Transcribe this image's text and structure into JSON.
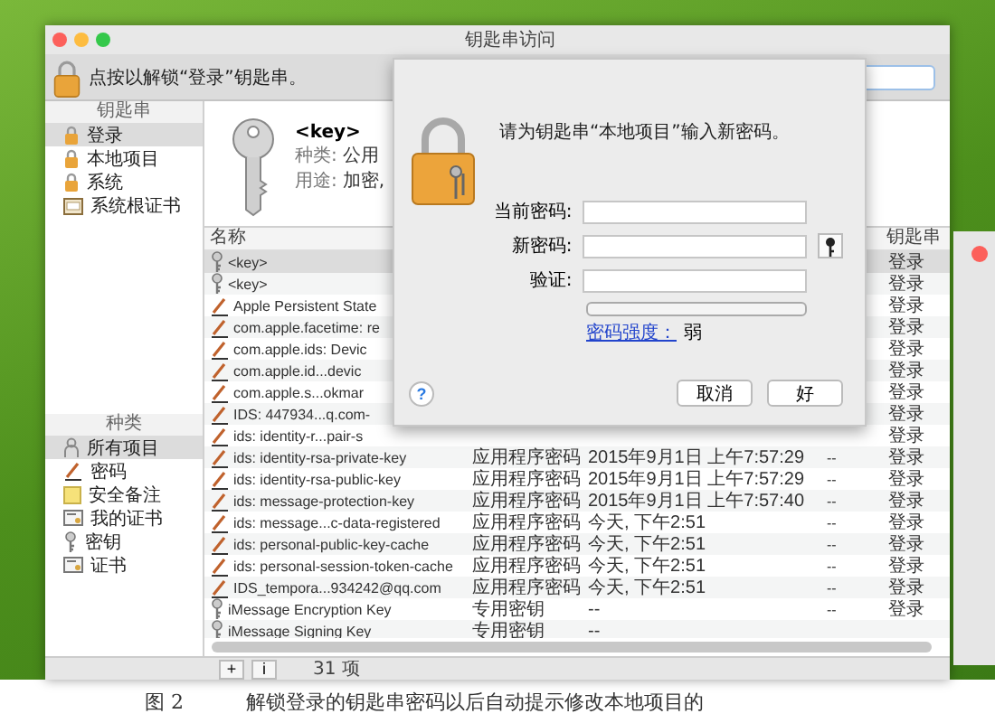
{
  "window": {
    "title": "钥匙串访问",
    "lock_message": "点按以解锁“登录”钥匙串。"
  },
  "sidebar": {
    "keychains_heading": "钥匙串",
    "keychains": [
      {
        "label": "登录",
        "kind": "lock",
        "selected": true
      },
      {
        "label": "本地项目",
        "kind": "lock",
        "selected": false
      },
      {
        "label": "系统",
        "kind": "lock",
        "selected": false
      },
      {
        "label": "系统根证书",
        "kind": "cabinet",
        "selected": false
      }
    ],
    "categories_heading": "种类",
    "categories": [
      {
        "label": "所有项目",
        "kind": "people",
        "selected": true
      },
      {
        "label": "密码",
        "kind": "pen",
        "selected": false
      },
      {
        "label": "安全备注",
        "kind": "note",
        "selected": false
      },
      {
        "label": "我的证书",
        "kind": "cert",
        "selected": false
      },
      {
        "label": "密钥",
        "kind": "key",
        "selected": false
      },
      {
        "label": "证书",
        "kind": "cert",
        "selected": false
      }
    ]
  },
  "detail": {
    "name": "<key>",
    "fields": [
      {
        "label": "种类:",
        "value": "公用"
      },
      {
        "label": "用途:",
        "value": "加密,"
      }
    ]
  },
  "table": {
    "columns": [
      "名称",
      "钥匙串"
    ],
    "rows": [
      {
        "kind": "key",
        "name": "<key>",
        "keychain": "登录",
        "selected": true
      },
      {
        "kind": "key",
        "name": "<key>",
        "keychain": "登录",
        "selected": false
      },
      {
        "kind": "password",
        "name": "Apple Persistent State",
        "keychain": "登录",
        "selected": false
      },
      {
        "kind": "password",
        "name": "com.apple.facetime: re",
        "keychain": "登录",
        "selected": false
      },
      {
        "kind": "password",
        "name": "com.apple.ids: Devic",
        "keychain": "登录",
        "selected": false
      },
      {
        "kind": "password",
        "name": "com.apple.id...devic",
        "keychain": "登录",
        "selected": false
      },
      {
        "kind": "password",
        "name": "com.apple.s...okmar",
        "keychain": "登录",
        "selected": false
      },
      {
        "kind": "password",
        "name": "IDS: 447934...q.com-",
        "keychain": "登录",
        "selected": false
      },
      {
        "kind": "password",
        "name": "ids: identity-r...pair-s",
        "keychain": "登录",
        "selected": false
      },
      {
        "kind": "password",
        "name": "ids: identity-rsa-private-key",
        "column_2": "应用程序密码",
        "column_3": "2015年9月1日 上午7:57:29",
        "column_4": "--",
        "keychain": "登录",
        "selected": false
      },
      {
        "kind": "password",
        "name": "ids: identity-rsa-public-key",
        "column_2": "应用程序密码",
        "column_3": "2015年9月1日 上午7:57:29",
        "column_4": "--",
        "keychain": "登录",
        "selected": false
      },
      {
        "kind": "password",
        "name": "ids: message-protection-key",
        "column_2": "应用程序密码",
        "column_3": "2015年9月1日 上午7:57:40",
        "column_4": "--",
        "keychain": "登录",
        "selected": false
      },
      {
        "kind": "password",
        "name": "ids: message...c-data-registered",
        "column_2": "应用程序密码",
        "column_3": "今天, 下午2:51",
        "column_4": "--",
        "keychain": "登录",
        "selected": false
      },
      {
        "kind": "password",
        "name": "ids: personal-public-key-cache",
        "column_2": "应用程序密码",
        "column_3": "今天, 下午2:51",
        "column_4": "--",
        "keychain": "登录",
        "selected": false
      },
      {
        "kind": "password",
        "name": "ids: personal-session-token-cache",
        "column_2": "应用程序密码",
        "column_3": "今天, 下午2:51",
        "column_4": "--",
        "keychain": "登录",
        "selected": false
      },
      {
        "kind": "password",
        "name": "IDS_tempora...934242@qq.com",
        "column_2": "应用程序密码",
        "column_3": "今天, 下午2:51",
        "column_4": "--",
        "keychain": "登录",
        "selected": false
      },
      {
        "kind": "key",
        "name": "iMessage Encryption Key",
        "column_2": "专用密钥",
        "column_3": "--",
        "column_4": "--",
        "keychain": "登录",
        "selected": false
      },
      {
        "kind": "key",
        "name": "iMessage Signing Key",
        "column_2": "专用密钥",
        "column_3": "--",
        "selected": false
      }
    ]
  },
  "status_bar": {
    "buttons": [
      "+",
      "i"
    ],
    "count": "31 项"
  },
  "dialog": {
    "message": "请为钥匙串“本地项目”输入新密码。",
    "fields": [
      {
        "label": "当前密码:",
        "key_button": false
      },
      {
        "label": "新密码:",
        "key_button": true
      },
      {
        "label": "验证:",
        "key_button": false
      }
    ],
    "strength": {
      "level": 0
    },
    "strength_label": "密码强度：",
    "strength_value": "弱",
    "help": "?",
    "buttons": [
      {
        "label": "取消"
      },
      {
        "label": "好"
      }
    ]
  },
  "caption": {
    "figure": "图 2",
    "text": "解锁登录的钥匙串密码以后自动提示修改本地项目的"
  }
}
